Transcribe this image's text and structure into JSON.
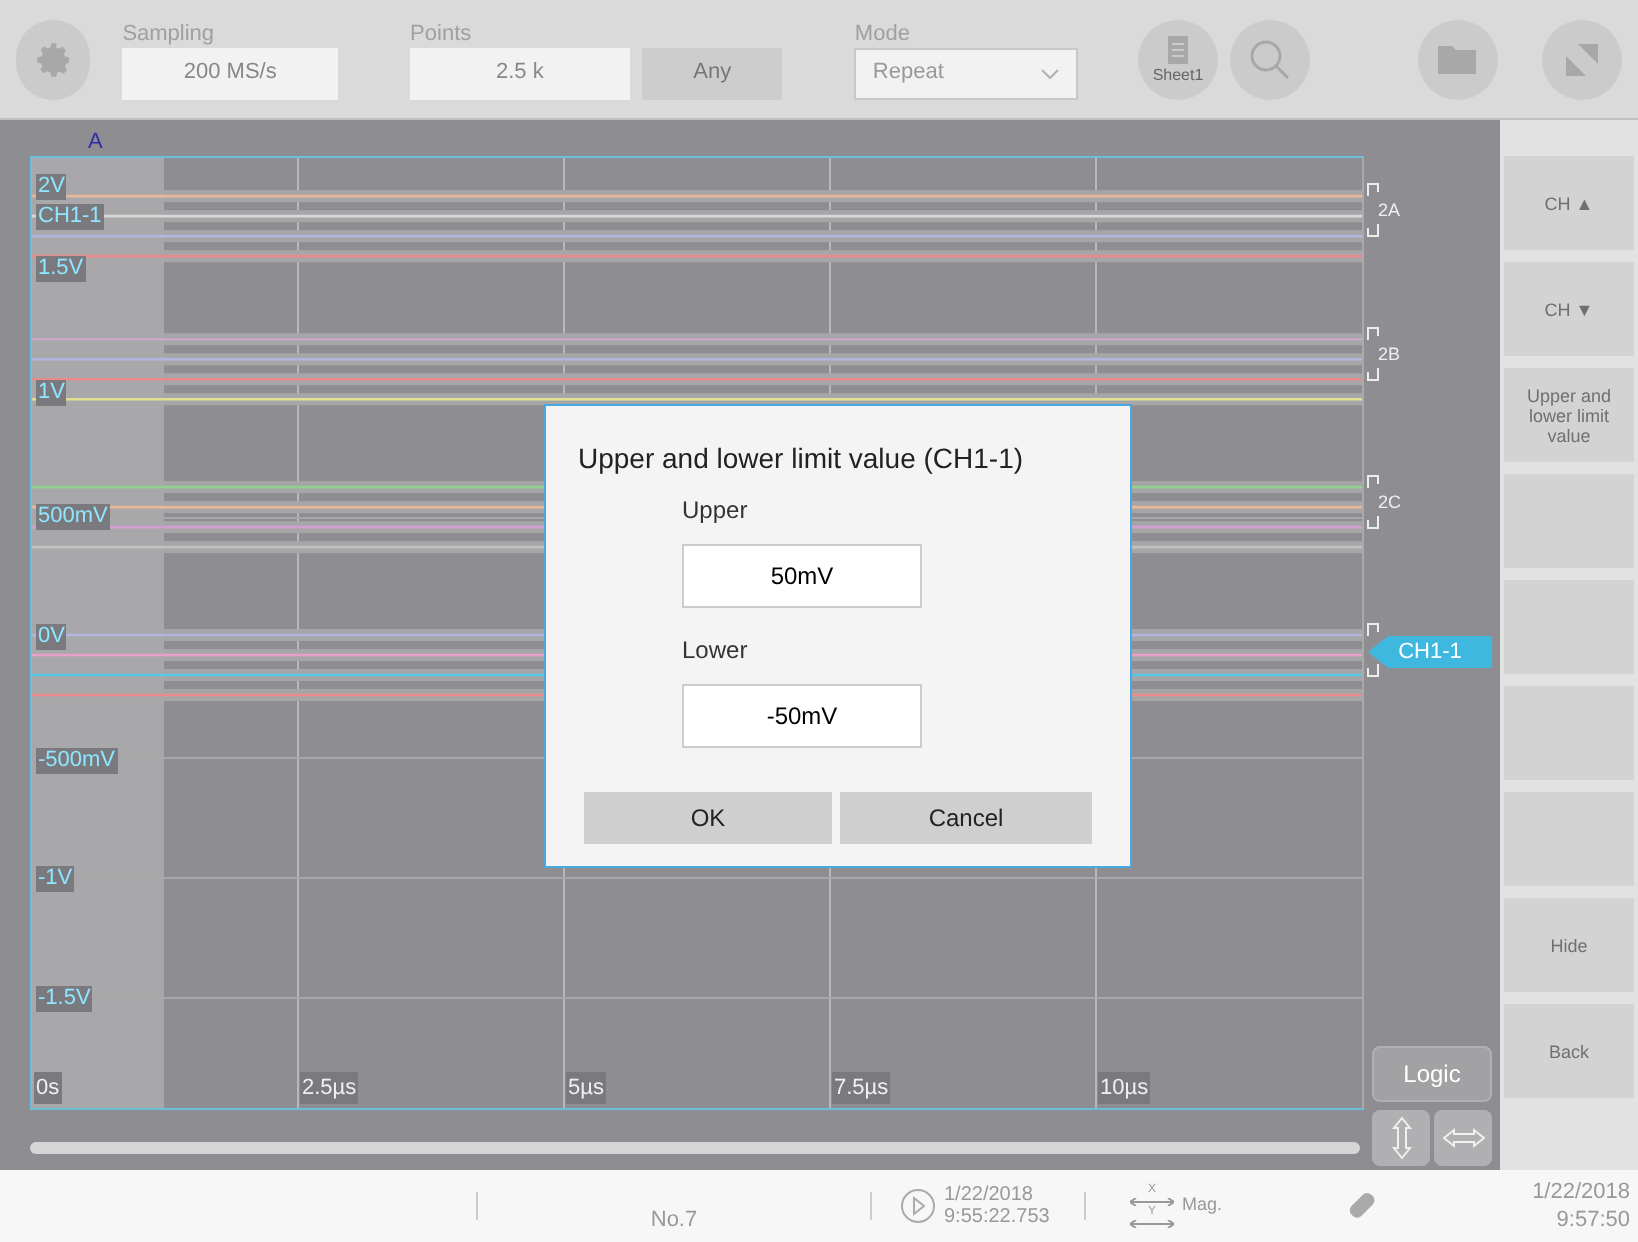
{
  "toolbar": {
    "sampling": {
      "label": "Sampling",
      "value": "200 MS/s"
    },
    "points": {
      "label": "Points",
      "value": "2.5 k"
    },
    "any_button": {
      "label": "Any",
      "disabled": true
    },
    "mode": {
      "label": "Mode",
      "value": "Repeat"
    },
    "sheet_label": "Sheet1"
  },
  "plot": {
    "top_label": "A",
    "y_labels": [
      "2V",
      "CH1-1",
      "1.5V",
      "1V",
      "500mV",
      "0V",
      "-500mV",
      "-1V",
      "-1.5V"
    ],
    "x_labels": [
      "0s",
      "2.5µs",
      "5µs",
      "7.5µs",
      "10µs"
    ],
    "channel_groups": [
      "2A",
      "2B",
      "2C"
    ],
    "active_channel": "CH1-1",
    "logic_button": "Logic"
  },
  "side_buttons": [
    {
      "kind": "label",
      "label": "CH ▲"
    },
    {
      "kind": "label",
      "label": "CH ▼"
    },
    {
      "kind": "label",
      "label": "Upper and lower limit value"
    },
    {
      "kind": "blank"
    },
    {
      "kind": "blank"
    },
    {
      "kind": "blank"
    },
    {
      "kind": "blank"
    },
    {
      "kind": "label",
      "label": "Hide"
    },
    {
      "kind": "label",
      "label": "Back"
    }
  ],
  "dialog": {
    "title": "Upper and lower limit value (CH1-1)",
    "upper_label": "Upper",
    "upper_value": "50mV",
    "lower_label": "Lower",
    "lower_value": "-50mV",
    "ok": "OK",
    "cancel": "Cancel"
  },
  "status_bar": {
    "number": "No.7",
    "start_date": "1/22/2018",
    "start_time": "9:55:22.753",
    "mag_label": "Mag.",
    "mag_x": "X",
    "mag_y": "Y",
    "date": "1/22/2018",
    "time": "9:57:50"
  }
}
